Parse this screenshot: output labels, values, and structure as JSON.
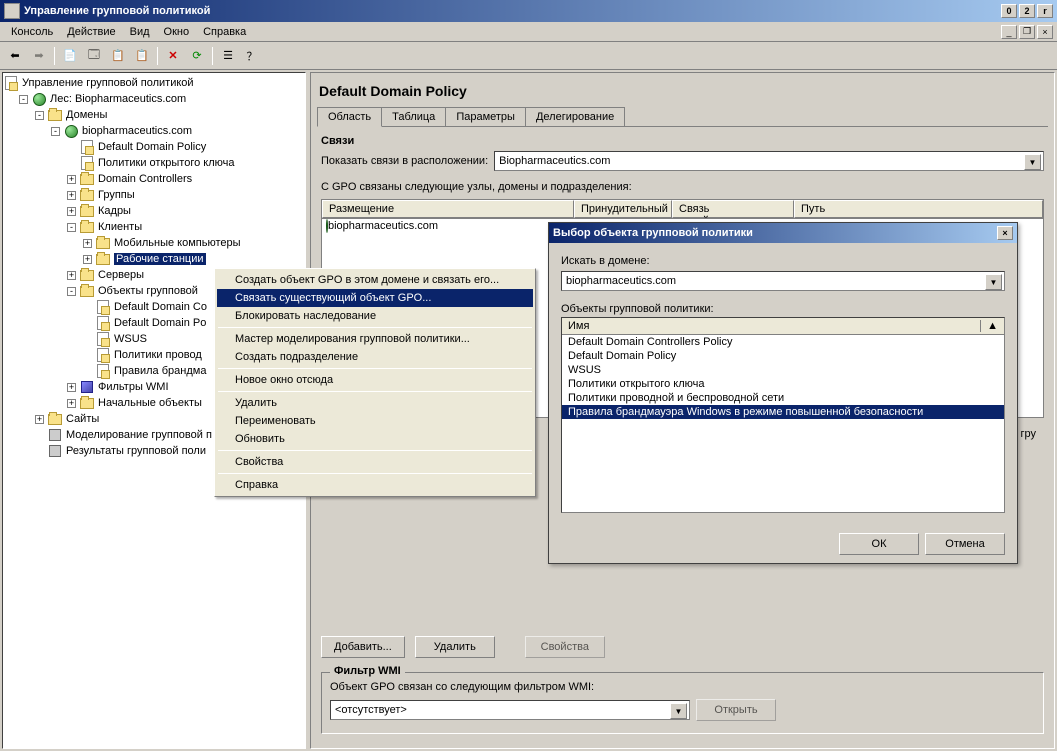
{
  "window": {
    "title": "Управление групповой политикой"
  },
  "win_btns": {
    "min": "0",
    "max": "2",
    "close": "r"
  },
  "menu": [
    "Консоль",
    "Действие",
    "Вид",
    "Окно",
    "Справка"
  ],
  "tree": {
    "root": "Управление групповой политикой",
    "forest": "Лес: Biopharmaceutics.com",
    "domains": "Домены",
    "domain": "biopharmaceutics.com",
    "items": {
      "ddp": "Default Domain Policy",
      "pki": "Политики открытого ключа",
      "dc": "Domain Controllers",
      "groups": "Группы",
      "staff": "Кадры",
      "clients": "Клиенты",
      "mobile": "Мобильные компьютеры",
      "workstations": "Рабочие станции",
      "servers": "Серверы",
      "gpo_objects": "Объекты групповой",
      "ddcp": "Default Domain Co",
      "ddp2": "Default Domain Po",
      "wsus": "WSUS",
      "wired": "Политики провод",
      "firewall": "Правила брандма",
      "wmi": "Фильтры WMI",
      "starter": "Начальные объекты",
      "sites": "Сайты",
      "modeling": "Моделирование групповой п",
      "results": "Результаты групповой поли"
    }
  },
  "content": {
    "header": "Default Domain Policy",
    "tabs": [
      "Область",
      "Таблица",
      "Параметры",
      "Делегирование"
    ],
    "links_title": "Связи",
    "show_links_label": "Показать связи в расположении:",
    "location_value": "Biopharmaceutics.com",
    "linked_label": "С GPO связаны следующие узлы, домены и подразделения:",
    "cols": {
      "loc": "Размещение",
      "enforced": "Принудительный",
      "link": "Связь задействована",
      "path": "Путь"
    },
    "row_domain": "biopharmaceutics.com",
    "add_btn": "Добавить...",
    "del_btn": "Удалить",
    "props_btn": "Свойства",
    "wmi_title": "Фильтр WMI",
    "wmi_label": "Объект GPO связан со следующим фильтром WMI:",
    "wmi_value": "<отсутствует>",
    "open_btn": "Открыть",
    "to_group": "к гру"
  },
  "context_menu": [
    "Создать объект GPO в этом домене и связать его...",
    "Связать существующий объект GPO...",
    "Блокировать наследование",
    "-",
    "Мастер моделирования групповой политики...",
    "Создать подразделение",
    "-",
    "Новое окно отсюда",
    "-",
    "Удалить",
    "Переименовать",
    "Обновить",
    "-",
    "Свойства",
    "-",
    "Справка"
  ],
  "dialog": {
    "title": "Выбор объекта групповой политики",
    "search_label": "Искать в домене:",
    "search_value": "biopharmaceutics.com",
    "objects_label": "Объекты групповой политики:",
    "name_col": "Имя",
    "arrow": "▲",
    "items": [
      "Default Domain Controllers Policy",
      "Default Domain Policy",
      "WSUS",
      "Политики открытого ключа",
      "Политики проводной и беспроводной сети",
      "Правила брандмауэра Windows в режиме повышенной безопасности"
    ],
    "ok": "ОК",
    "cancel": "Отмена"
  }
}
